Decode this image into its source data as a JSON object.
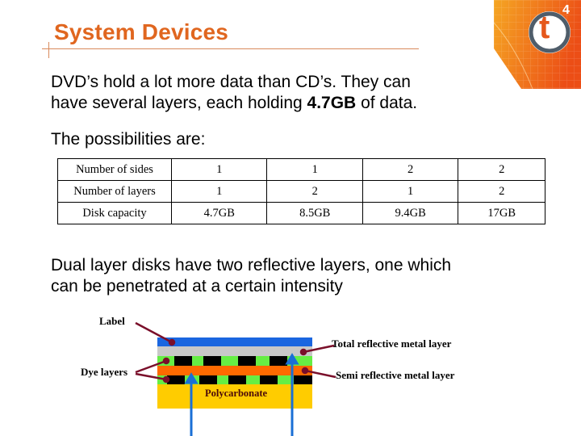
{
  "slide": {
    "title": "System Devices",
    "logo": {
      "text": "t",
      "superscript": "4",
      "name": "t4-logo"
    },
    "colors": {
      "title": "#e0661f",
      "accent_orange": "#f07a1e",
      "logo_ring": "#4f5d6a"
    }
  },
  "intro": {
    "line1": "DVD’s  hold a lot more data than CD’s.  They can",
    "line2_pre": "have several layers, each holding ",
    "line2_bold": "4.7GB",
    "line2_post": " of data."
  },
  "possibilities_label": "The possibilities are:",
  "table": {
    "rows": [
      {
        "header": "Number of sides",
        "values": [
          "1",
          "1",
          "2",
          "2"
        ]
      },
      {
        "header": "Number of layers",
        "values": [
          "1",
          "2",
          "1",
          "2"
        ]
      },
      {
        "header": "Disk capacity",
        "values": [
          "4.7GB",
          "8.5GB",
          "9.4GB",
          "17GB"
        ]
      }
    ]
  },
  "dual_layer": {
    "line1": "Dual layer disks have two reflective layers, one which",
    "line2": "can be penetrated at a certain intensity"
  },
  "diagram": {
    "labels": {
      "label": "Label",
      "total_reflective": "Total reflective metal layer",
      "dye_layers": "Dye layers",
      "semi_reflective": "Semi reflective metal layer",
      "polycarbonate": "Polycarbonate"
    },
    "colors": {
      "label_layer": "#1a66e0",
      "total_reflective_layer": "#c8c8c8",
      "dye_layer": "#66ee44",
      "pits": "#000000",
      "semi_reflective_layer": "#ff6a00",
      "polycarbonate": "#ffcc00",
      "pointer": "#7a0f2a",
      "laser": "#1a6fd6"
    }
  }
}
